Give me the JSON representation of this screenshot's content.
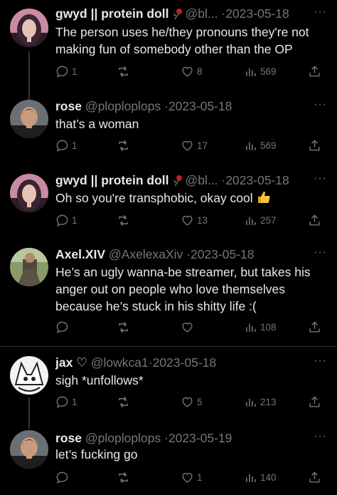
{
  "tweets": [
    {
      "name": "gwyd || protein doll",
      "handle": "@bl...",
      "sep": "·",
      "date": "2023-05-18",
      "text": "The person uses he/they pronouns they're not making fun of somebody other than the OP",
      "replies": "1",
      "retweets": "",
      "likes": "8",
      "views": "569"
    },
    {
      "name": "rose",
      "handle": "@ploploplops",
      "sep": "·",
      "date": "2023-05-18",
      "text": "that’s a woman",
      "replies": "1",
      "retweets": "",
      "likes": "17",
      "views": "569"
    },
    {
      "name": "gwyd || protein doll",
      "handle": "@bl...",
      "sep": "·",
      "date": "2023-05-18",
      "text": "Oh so you're transphobic, okay cool",
      "replies": "1",
      "retweets": "",
      "likes": "13",
      "views": "257"
    },
    {
      "name": "Axel.XIV",
      "handle": "@AxelexaXiv",
      "sep": "·",
      "date": "2023-05-18",
      "text": "He’s an ugly wanna-be streamer, but takes his anger out on people who love themselves because he’s stuck in his shitty life :(",
      "replies": "",
      "retweets": "",
      "likes": "",
      "views": "108"
    },
    {
      "name": "jax ♡",
      "handle": "@lowkca1",
      "sep": "·",
      "date": "2023-05-18",
      "text": "sigh *unfollows*",
      "replies": "1",
      "retweets": "",
      "likes": "5",
      "views": "213"
    },
    {
      "name": "rose",
      "handle": "@ploploplops",
      "sep": "·",
      "date": "2023-05-19",
      "text": "let’s fucking go",
      "replies": "",
      "retweets": "",
      "likes": "1",
      "views": "140"
    }
  ],
  "more_label": "···",
  "colors": {
    "background": "#000000",
    "text": "#e7e9ea",
    "muted": "#71767b",
    "divider": "#2f3336"
  },
  "icons": [
    "reply-icon",
    "retweet-icon",
    "like-icon",
    "views-icon",
    "share-icon",
    "rose-emoji-icon",
    "thumbs-up-emoji-icon"
  ]
}
